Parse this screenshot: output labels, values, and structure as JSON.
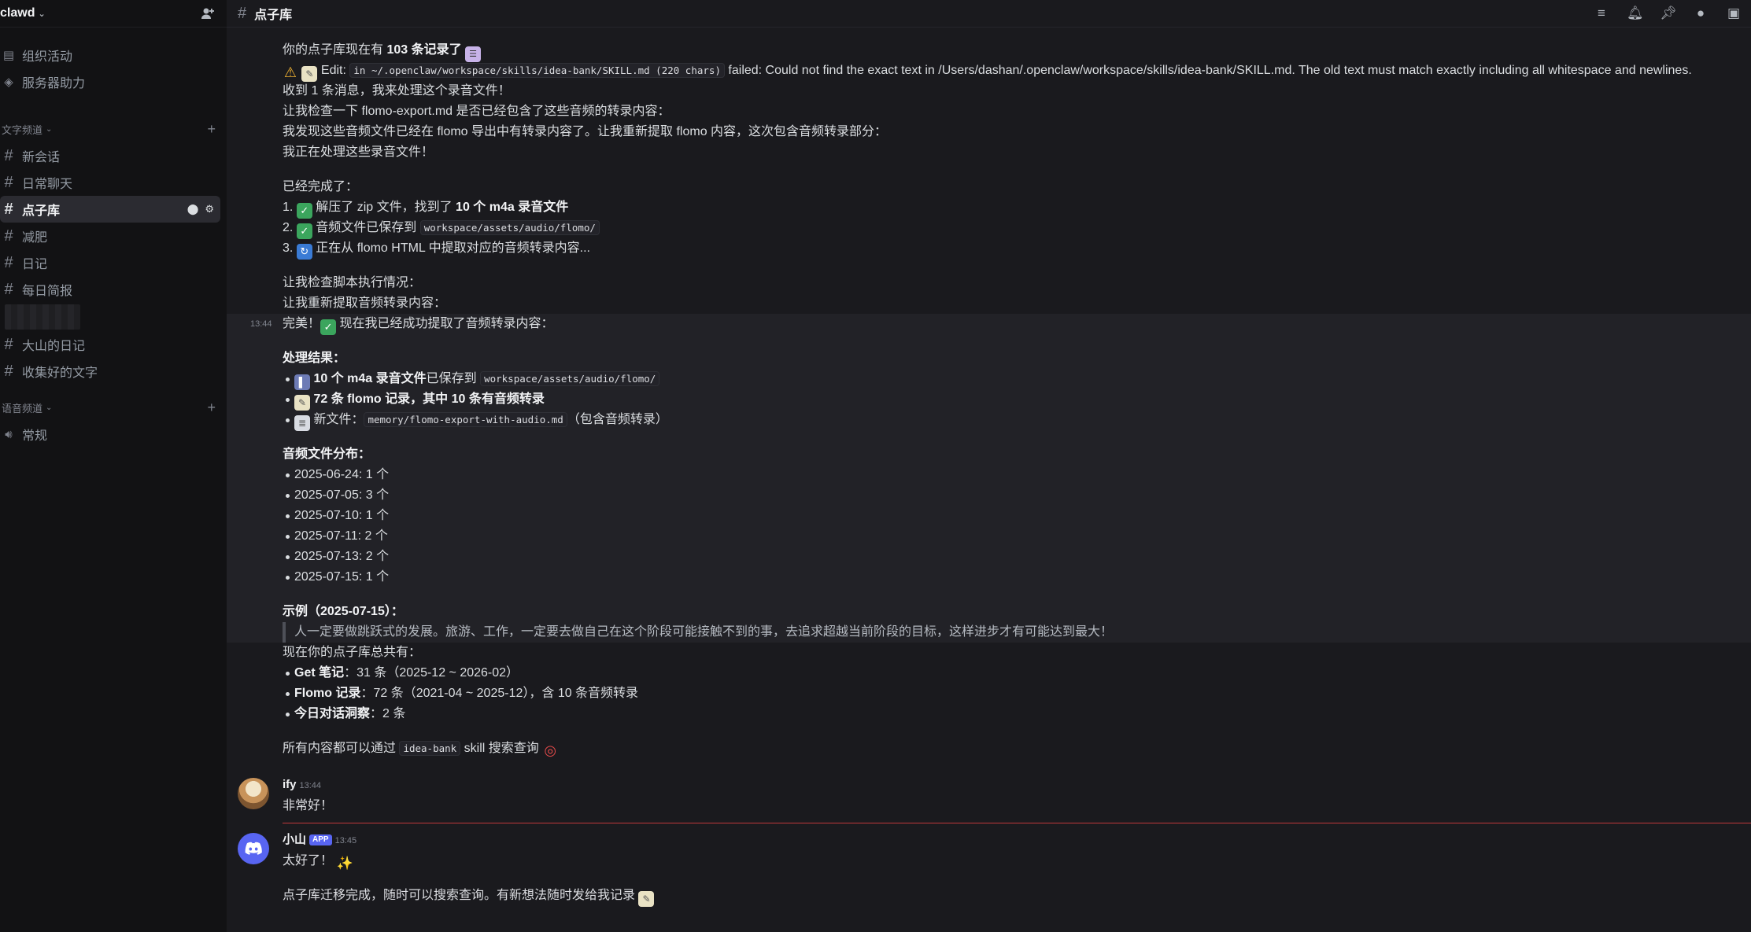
{
  "server": {
    "name": "clawd"
  },
  "nav_top": [
    {
      "icon": "calendar-icon",
      "label": "组织活动"
    },
    {
      "icon": "boost-icon",
      "label": "服务器助力"
    }
  ],
  "text_category": "文字频道",
  "text_channels": [
    "新会话",
    "日常聊天",
    "点子库",
    "减肥",
    "日记",
    "每日简报",
    "大山的日记",
    "收集好的文字"
  ],
  "voice_category": "语音频道",
  "voice_channels": [
    "常规"
  ],
  "channel": {
    "title": "点子库"
  },
  "messages": {
    "block1": {
      "l1_pre": "你的点子库现在有 ",
      "l1_bold": "103 条记录了",
      "l2_edit": "Edit: ",
      "l2_code": "in ~/.openclaw/workspace/skills/idea-bank/SKILL.md (220 chars)",
      "l2_rest": " failed: Could not find the exact text in /Users/dashan/.openclaw/workspace/skills/idea-bank/SKILL.md. The old text must match exactly including all whitespace and newlines.",
      "l3": "收到 1 条消息，我来处理这个录音文件！",
      "l4": "让我检查一下 flomo-export.md 是否已经包含了这些音频的转录内容：",
      "l5": "我发现这些音频文件已经在 flomo 导出中有转录内容了。让我重新提取 flomo 内容，这次包含音频转录部分：",
      "l6": "我正在处理这些录音文件！",
      "done_title": "已经完成了：",
      "s1_num": "1.",
      "s1_pre": " 解压了 zip 文件，找到了 ",
      "s1_bold": "10 个 m4a 录音文件",
      "s2_num": "2.",
      "s2_pre": " 音频文件已保存到 ",
      "s2_code": "workspace/assets/audio/flomo/",
      "s3_num": "3.",
      "s3_text": " 正在从 flomo HTML 中提取对应的音频转录内容...",
      "l7": "让我检查脚本执行情况：",
      "l8": "让我重新提取音频转录内容："
    },
    "block2": {
      "time": "13:44",
      "l1_pre": "完美！",
      "l1_post": " 现在我已经成功提取了音频转录内容：",
      "result_title": "处理结果：",
      "r1_bold": "10 个 m4a 录音文件",
      "r1_post": "已保存到 ",
      "r1_code": "workspace/assets/audio/flomo/",
      "r2_bold": "72 条 flomo 记录，其中 10 条有音频转录",
      "r3_pre": "新文件：",
      "r3_code": "memory/flomo-export-with-audio.md",
      "r3_post": "（包含音频转录）",
      "dist_title": "音频文件分布：",
      "dist": [
        "2025-06-24: 1 个",
        "2025-07-05: 3 个",
        "2025-07-10: 1 个",
        "2025-07-11: 2 个",
        "2025-07-13: 2 个",
        "2025-07-15: 1 个"
      ],
      "example_title": "示例（2025-07-15）：",
      "example_quote": "人一定要做跳跃式的发展。旅游、工作，一定要去做自己在这个阶段可能接触不到的事，去追求超越当前阶段的目标，这样进步才有可能达到最大！"
    },
    "block3": {
      "l1": "现在你的点子库总共有：",
      "b1_bold": "Get 笔记",
      "b1_rest": "：31 条（2025-12 ~ 2026-02）",
      "b2_bold": "Flomo 记录",
      "b2_rest": "：72 条（2021-04 ~ 2025-12），含 10 条音频转录",
      "b3_bold": "今日对话洞察",
      "b3_rest": "：2 条",
      "l2_pre": "所有内容都可以通过 ",
      "l2_code": "idea-bank",
      "l2_post": " skill 搜索查询"
    },
    "ify": {
      "name": "ify",
      "time": "13:44",
      "text": "非常好！"
    },
    "bot": {
      "name": "小山",
      "badge": "APP",
      "time": "13:45",
      "l1": "太好了！",
      "l2": "点子库迁移完成，随时可以搜索查询。有新想法随时发给我记录"
    }
  }
}
